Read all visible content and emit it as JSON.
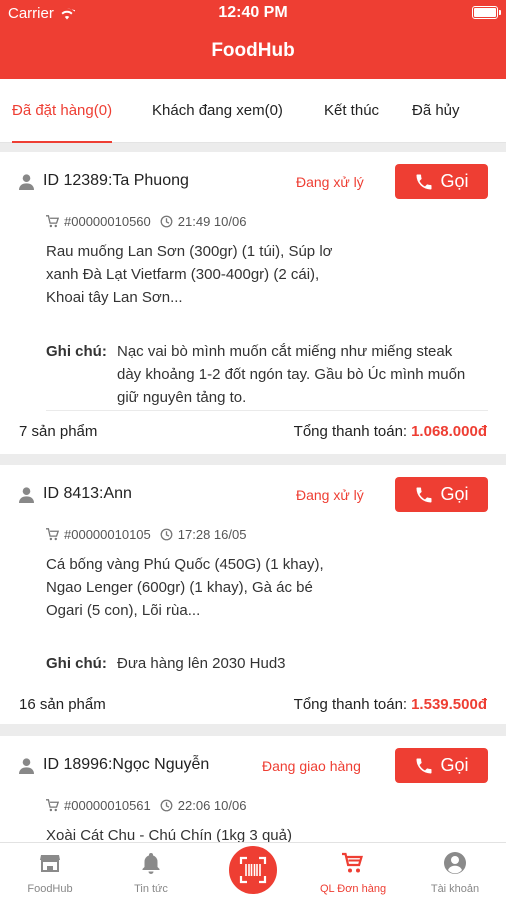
{
  "status_bar": {
    "carrier": "Carrier",
    "time": "12:40 PM"
  },
  "header": {
    "title": "FoodHub"
  },
  "tabs": [
    {
      "label": "Đã đặt hàng(0)",
      "active": true
    },
    {
      "label": "Khách đang xem(0)",
      "active": false
    },
    {
      "label": "Kết thúc",
      "active": false
    },
    {
      "label": "Đã hủy",
      "active": false
    }
  ],
  "call_label": "Gọi",
  "orders": [
    {
      "id_text": "ID 12389:Ta Phuong",
      "status": "Đang xử lý",
      "code": "#00000010560",
      "time": "21:49 10/06",
      "items": "Rau muống Lan Sơn (300gr) (1 túi), Súp lơ xanh Đà Lạt Vietfarm (300-400gr) (2 cái), Khoai tây Lan Sơn...",
      "note_label": "Ghi chú:",
      "note": "Nạc vai bò mình muốn cắt miếng như miếng steak dày khoảng 1-2 đốt ngón tay. Gầu bò Úc mình muốn giữ nguyên tảng to.",
      "count": "7 sản phẩm",
      "total_label": "Tổng thanh toán:",
      "total": "1.068.000đ"
    },
    {
      "id_text": "ID 8413:Ann",
      "status": "Đang xử lý",
      "code": "#00000010105",
      "time": "17:28 16/05",
      "items": "Cá bống vàng Phú Quốc (450G) (1 khay), Ngao Lenger (600gr) (1 khay), Gà ác bé Ogari (5 con), Lõi rùa...",
      "note_label": "Ghi chú:",
      "note": "Đưa hàng lên 2030 Hud3",
      "count": "16 sản phẩm",
      "total_label": "Tổng thanh toán:",
      "total": "1.539.500đ"
    },
    {
      "id_text": "ID 18996:Ngọc Nguyễn",
      "status": "Đang giao hàng",
      "code": "#00000010561",
      "time": "22:06 10/06",
      "items": "Xoài Cát Chu - Chú Chín (1kg 3 quả)"
    }
  ],
  "bottom_nav": [
    {
      "label": "FoodHub",
      "icon": "store-icon",
      "active": false
    },
    {
      "label": "Tin tức",
      "icon": "bell-icon",
      "active": false
    },
    {
      "label": "QL Đơn hàng",
      "icon": "cart-icon",
      "active": true
    },
    {
      "label": "Tài khoản",
      "icon": "account-icon",
      "active": false
    }
  ],
  "colors": {
    "accent": "#ee3e33",
    "background": "#ececec"
  }
}
